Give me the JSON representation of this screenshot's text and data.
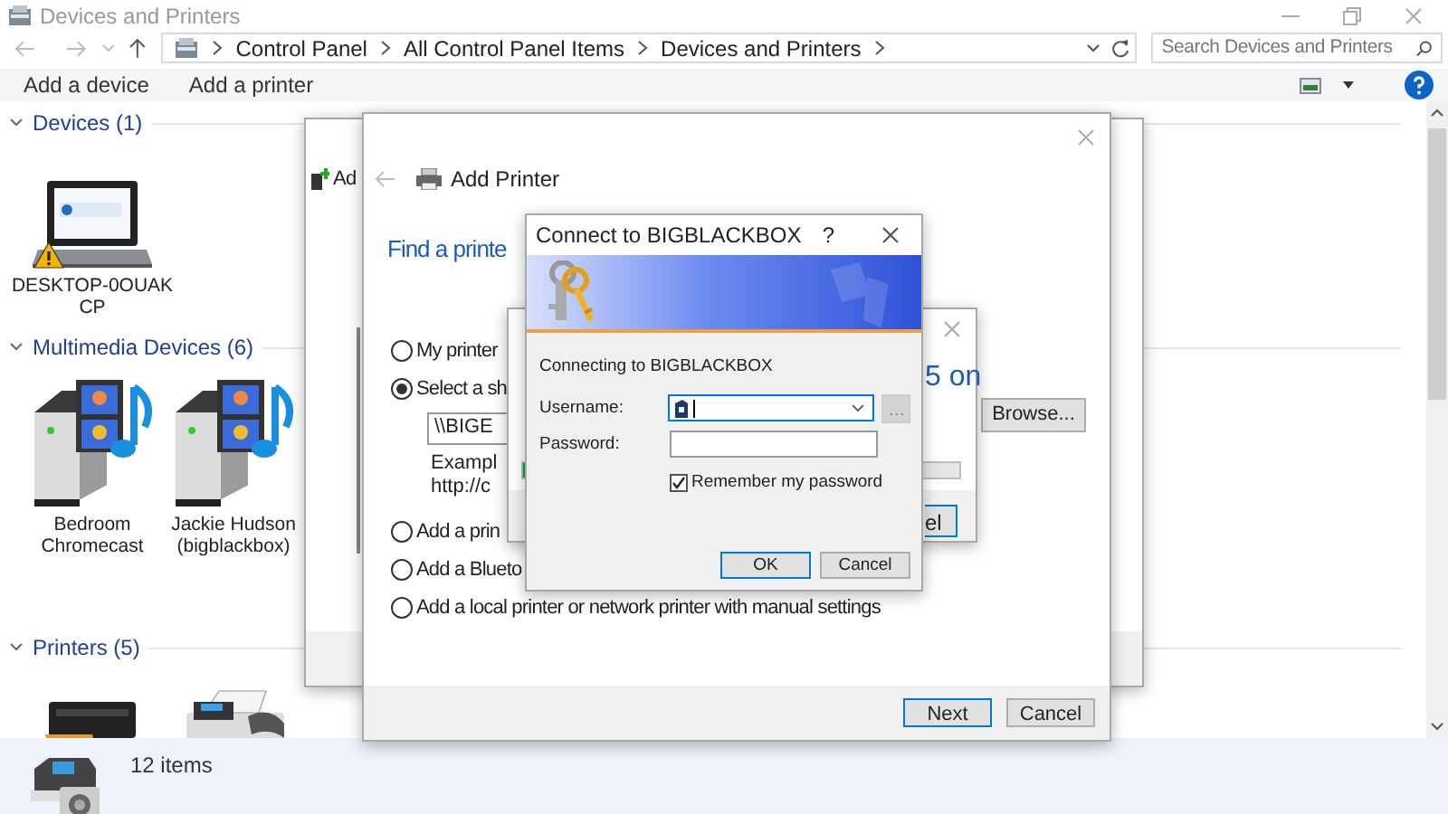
{
  "explorer": {
    "title": "Devices and Printers",
    "breadcrumb": [
      "Control Panel",
      "All Control Panel Items",
      "Devices and Printers"
    ],
    "search": {
      "placeholder": "Search Devices and Printers"
    },
    "toolbar": [
      "Add a device",
      "Add a printer"
    ],
    "groups": [
      {
        "title": "Devices (1)",
        "items": [
          {
            "label": "DESKTOP-0OUAK CP",
            "kind": "laptop"
          }
        ]
      },
      {
        "title": "Multimedia Devices (6)",
        "items": [
          {
            "label": "Bedroom Chromecast",
            "kind": "media"
          },
          {
            "label": "Jackie Hudson (bigblackbox)",
            "kind": "media"
          }
        ]
      },
      {
        "title": "Printers (5)",
        "items": [
          {
            "kind": "inkjet"
          },
          {
            "kind": "fax"
          }
        ]
      }
    ],
    "status": "12 items"
  },
  "add_device_window": {
    "title": "Ad"
  },
  "add_printer": {
    "title": "Add Printer",
    "heading": "Find a printe",
    "options": [
      {
        "label": "My printer",
        "selected": false
      },
      {
        "label": "Select a sh",
        "selected": true
      },
      {
        "label": "Add a prin",
        "selected": false
      },
      {
        "label": "Add a Blueto",
        "selected": false
      },
      {
        "label": "Add a local printer or network printer with manual settings",
        "selected": false
      }
    ],
    "path_value": "\\\\BIGE",
    "example": [
      "Exampl",
      "http://c"
    ],
    "browse": "Browse...",
    "buttons": [
      "Next",
      "Cancel"
    ]
  },
  "progress_dialog": {
    "heading_tail": "5 on",
    "progress": {
      "level": 0.1
    },
    "cancel": "el"
  },
  "connect": {
    "title": "Connect to BIGBLACKBOX",
    "help": "?",
    "message": "Connecting to BIGBLACKBOX",
    "username": {
      "label": "Username:"
    },
    "password": {
      "label": "Password:"
    },
    "remember": {
      "label": "Remember my password",
      "checked": true
    },
    "buttons": [
      "OK",
      "Cancel"
    ]
  }
}
